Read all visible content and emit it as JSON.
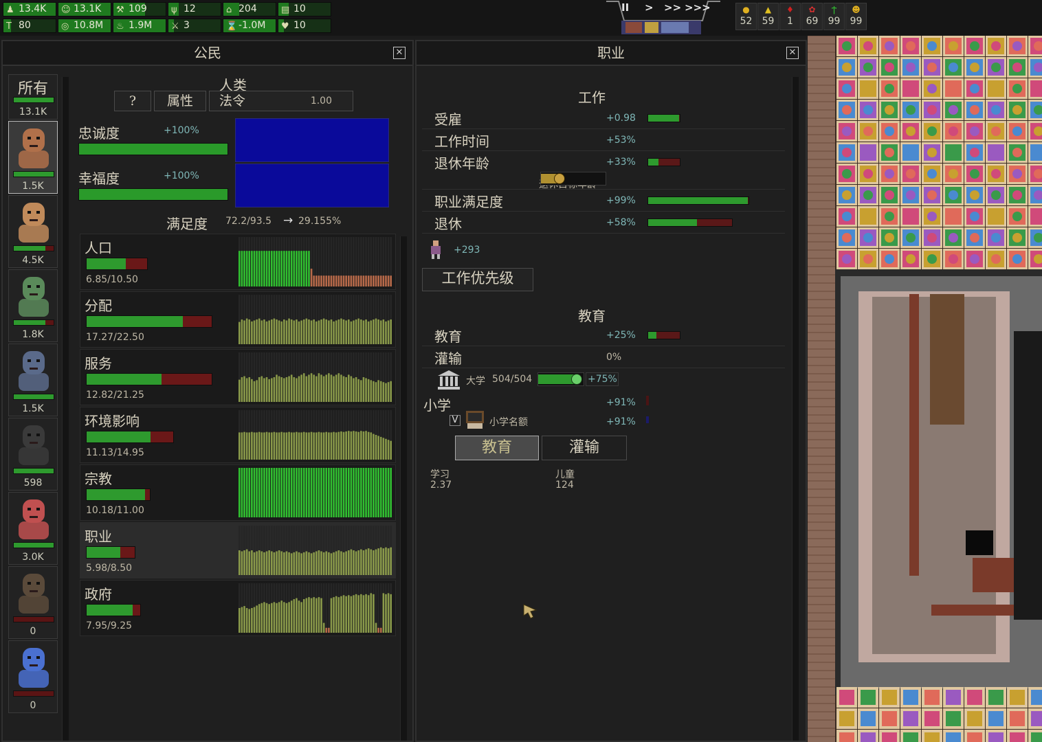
{
  "topbar": {
    "stats_row1": [
      {
        "icon": "citizens-icon",
        "value": "13.4K",
        "fill": 1.0
      },
      {
        "icon": "happy-icon",
        "value": "13.1K",
        "fill": 1.0
      },
      {
        "icon": "tools-icon",
        "value": "109",
        "fill": 0.6
      },
      {
        "icon": "wheat-icon",
        "value": "12",
        "fill": 0.2
      },
      {
        "icon": "house-icon",
        "value": "204",
        "fill": 0.3
      },
      {
        "icon": "bed-icon",
        "value": "10",
        "fill": 0.2
      }
    ],
    "stats_row2": [
      {
        "icon": "hammer-icon",
        "value": "80",
        "fill": 0.15
      },
      {
        "icon": "coins-icon",
        "value": "10.8M",
        "fill": 1.0
      },
      {
        "icon": "flask-icon",
        "value": "1.9M",
        "fill": 1.0
      },
      {
        "icon": "sword-icon",
        "value": "3",
        "fill": 0.1
      },
      {
        "icon": "hourglass-icon",
        "value": "-1.0M",
        "fill": 1.0
      },
      {
        "icon": "heart-icon",
        "value": "10",
        "fill": 0.1
      }
    ],
    "speed_buttons": [
      "II",
      ">",
      ">>",
      ">>>"
    ],
    "counters": [
      {
        "icon": "coin-icon",
        "value": "52"
      },
      {
        "icon": "warning-icon",
        "value": "59"
      },
      {
        "icon": "drop-icon",
        "value": "1"
      },
      {
        "icon": "brain-icon",
        "value": "69"
      },
      {
        "icon": "plant-icon",
        "value": "99"
      },
      {
        "icon": "face-icon",
        "value": "99"
      }
    ]
  },
  "citizens_panel": {
    "title": "公民",
    "close": "✕",
    "species": [
      {
        "name": "所有",
        "count": "13.1K",
        "bar": 1.0
      },
      {
        "name": "human",
        "count": "1.5K",
        "bar": 1.0
      },
      {
        "name": "dwarf",
        "count": "4.5K",
        "bar": 0.8
      },
      {
        "name": "orc",
        "count": "1.8K",
        "bar": 0.8
      },
      {
        "name": "argonian",
        "count": "1.5K",
        "bar": 1.0
      },
      {
        "name": "cretonian",
        "count": "598",
        "bar": 1.0
      },
      {
        "name": "garthimi",
        "count": "3.0K",
        "bar": 1.0
      },
      {
        "name": "tilapi",
        "count": "0",
        "bar": 0.0
      },
      {
        "name": "amevia",
        "count": "0",
        "bar": 0.0
      }
    ],
    "race_title": "人类",
    "buttons": {
      "help": "?",
      "attributes": "属性",
      "edict": "法令",
      "edict_value": "1.00"
    },
    "loyalty": {
      "label": "忠诚度",
      "value": "+100%"
    },
    "happiness": {
      "label": "幸福度",
      "value": "+100%"
    },
    "fulfillment": {
      "label": "满足度",
      "value": "72.2/93.5",
      "arrow": "→",
      "target": "29.155%"
    },
    "needs": [
      {
        "name": "人口",
        "value": "6.85/10.50",
        "fill": 0.65,
        "bars": [
          0.72,
          0.72,
          0.72,
          0.72,
          0.72,
          0.72,
          0.72,
          0.72,
          0.72,
          0.72,
          0.72,
          0.72,
          0.72,
          0.72,
          0.72,
          0.72,
          0.72,
          0.72,
          0.72,
          0.72,
          0.72,
          0.72,
          0.72,
          0.72,
          0.72,
          0.72,
          0.72,
          0.72,
          0.72,
          0.36,
          0.22,
          0.22,
          0.22,
          0.22,
          0.22,
          0.22,
          0.22,
          0.22,
          0.22,
          0.22,
          0.22,
          0.22,
          0.22,
          0.22,
          0.22,
          0.22,
          0.22,
          0.22,
          0.22,
          0.22,
          0.22,
          0.22,
          0.22,
          0.22,
          0.22,
          0.22,
          0.22,
          0.22,
          0.22,
          0.22,
          0.22,
          0.22
        ],
        "split": 29
      },
      {
        "name": "分配",
        "value": "17.27/22.50",
        "fill": 0.77,
        "bars": [
          0.45,
          0.5,
          0.48,
          0.52,
          0.5,
          0.46,
          0.48,
          0.5,
          0.52,
          0.48,
          0.5,
          0.46,
          0.48,
          0.5,
          0.52,
          0.5,
          0.48,
          0.46,
          0.5,
          0.48,
          0.52,
          0.5,
          0.48,
          0.5,
          0.46,
          0.48,
          0.5,
          0.52,
          0.5,
          0.48,
          0.5,
          0.46,
          0.48,
          0.5,
          0.52,
          0.5,
          0.48,
          0.5,
          0.46,
          0.48,
          0.5,
          0.52,
          0.5,
          0.48,
          0.5,
          0.46,
          0.48,
          0.5,
          0.52,
          0.5,
          0.48,
          0.5,
          0.46,
          0.48,
          0.5,
          0.52,
          0.5,
          0.48,
          0.5,
          0.46,
          0.48,
          0.5
        ],
        "split": 0
      },
      {
        "name": "服务",
        "value": "12.82/21.25",
        "fill": 0.6,
        "bars": [
          0.45,
          0.5,
          0.52,
          0.48,
          0.5,
          0.46,
          0.42,
          0.44,
          0.5,
          0.52,
          0.48,
          0.5,
          0.46,
          0.48,
          0.5,
          0.55,
          0.52,
          0.5,
          0.48,
          0.5,
          0.52,
          0.55,
          0.5,
          0.48,
          0.52,
          0.55,
          0.58,
          0.52,
          0.55,
          0.58,
          0.55,
          0.52,
          0.58,
          0.55,
          0.52,
          0.55,
          0.58,
          0.55,
          0.52,
          0.55,
          0.58,
          0.55,
          0.52,
          0.5,
          0.55,
          0.52,
          0.48,
          0.5,
          0.46,
          0.44,
          0.5,
          0.48,
          0.46,
          0.44,
          0.42,
          0.4,
          0.44,
          0.42,
          0.4,
          0.38,
          0.4,
          0.42
        ],
        "split": 0
      },
      {
        "name": "环境影响",
        "value": "11.13/14.95",
        "fill": 0.74,
        "bars": [
          0.55,
          0.55,
          0.56,
          0.55,
          0.55,
          0.56,
          0.55,
          0.55,
          0.56,
          0.55,
          0.55,
          0.56,
          0.55,
          0.55,
          0.56,
          0.55,
          0.55,
          0.56,
          0.55,
          0.55,
          0.56,
          0.55,
          0.55,
          0.56,
          0.55,
          0.55,
          0.56,
          0.55,
          0.55,
          0.56,
          0.55,
          0.55,
          0.56,
          0.55,
          0.55,
          0.56,
          0.55,
          0.55,
          0.56,
          0.55,
          0.56,
          0.57,
          0.56,
          0.57,
          0.58,
          0.57,
          0.58,
          0.57,
          0.56,
          0.58,
          0.57,
          0.58,
          0.56,
          0.55,
          0.52,
          0.5,
          0.48,
          0.46,
          0.44,
          0.42,
          0.4,
          0.38
        ],
        "split": 0
      },
      {
        "name": "宗教",
        "value": "10.18/11.00",
        "fill": 0.92,
        "bars": [
          1,
          1,
          1,
          1,
          1,
          1,
          1,
          1,
          1,
          1,
          1,
          1,
          1,
          1,
          1,
          1,
          1,
          1,
          1,
          1,
          1,
          1,
          1,
          1,
          1,
          1,
          1,
          1,
          1,
          1,
          1,
          1,
          1,
          1,
          1,
          1,
          1,
          1,
          1,
          1,
          1,
          1,
          1,
          1,
          1,
          1,
          1,
          1,
          1,
          1,
          1,
          1,
          1,
          1,
          1,
          1,
          1,
          1,
          1,
          1,
          1,
          1
        ],
        "split": 0,
        "bright": true
      },
      {
        "name": "职业",
        "value": "5.98/8.50",
        "fill": 0.7,
        "selected": true,
        "bars": [
          0.5,
          0.48,
          0.5,
          0.52,
          0.48,
          0.5,
          0.46,
          0.48,
          0.5,
          0.48,
          0.46,
          0.48,
          0.5,
          0.48,
          0.46,
          0.48,
          0.5,
          0.48,
          0.46,
          0.48,
          0.46,
          0.44,
          0.46,
          0.48,
          0.46,
          0.44,
          0.46,
          0.48,
          0.46,
          0.44,
          0.46,
          0.48,
          0.5,
          0.48,
          0.46,
          0.48,
          0.46,
          0.44,
          0.46,
          0.48,
          0.5,
          0.48,
          0.46,
          0.48,
          0.5,
          0.52,
          0.5,
          0.48,
          0.5,
          0.52,
          0.5,
          0.52,
          0.54,
          0.52,
          0.5,
          0.52,
          0.54,
          0.56,
          0.54,
          0.56,
          0.54,
          0.56
        ],
        "split": 0
      },
      {
        "name": "政府",
        "value": "7.95/9.25",
        "fill": 0.86,
        "bars": [
          0.5,
          0.52,
          0.54,
          0.5,
          0.48,
          0.5,
          0.52,
          0.55,
          0.58,
          0.6,
          0.62,
          0.6,
          0.58,
          0.6,
          0.62,
          0.6,
          0.62,
          0.65,
          0.62,
          0.6,
          0.62,
          0.65,
          0.68,
          0.7,
          0.65,
          0.62,
          0.68,
          0.7,
          0.72,
          0.7,
          0.72,
          0.7,
          0.72,
          0.7,
          0.2,
          0.0,
          0.0,
          0.7,
          0.72,
          0.74,
          0.72,
          0.74,
          0.76,
          0.74,
          0.76,
          0.74,
          0.76,
          0.78,
          0.76,
          0.78,
          0.76,
          0.78,
          0.76,
          0.8,
          0.78,
          0.2,
          0.0,
          0.0,
          0.8,
          0.78,
          0.8,
          0.78
        ],
        "split": 0
      }
    ]
  },
  "job_panel": {
    "title": "职业",
    "close": "✕",
    "work_title": "工作",
    "rows": [
      {
        "label": "受雇",
        "value": "+0.98",
        "bar": 0.98,
        "bar_w": 48
      },
      {
        "label": "工作时间",
        "value": "+53%"
      },
      {
        "label": "退休年龄",
        "value": "+33%",
        "bar": 0.33,
        "bar_w": 48
      },
      {
        "label": "职业满足度",
        "value": "+99%",
        "bar": 0.99,
        "bar_w": 148
      },
      {
        "label": "退休",
        "value": "+58%",
        "bar": 0.58,
        "bar_w": 124
      }
    ],
    "retire_target_label": "退休目标年龄",
    "retire_slider": 0.28,
    "retired_count": "+293",
    "work_priority": "工作优先级",
    "education_title": "教育",
    "edu_rows": [
      {
        "label": "教育",
        "value": "+25%",
        "bar": 0.25
      },
      {
        "label": "灌输",
        "value": "0%"
      }
    ],
    "university": {
      "label": "大学",
      "value": "504/504",
      "slider": 0.85,
      "bonus": "+75%"
    },
    "school_label": "小学",
    "school_value": "+91%",
    "school_quota": {
      "checkbox": "V",
      "label": "小学名额",
      "value": "+91%"
    },
    "tabs": {
      "education": "教育",
      "indoctrination": "灌输"
    },
    "learning": {
      "label": "学习",
      "value": "2.37"
    },
    "children": {
      "label": "儿童",
      "value": "124"
    }
  }
}
